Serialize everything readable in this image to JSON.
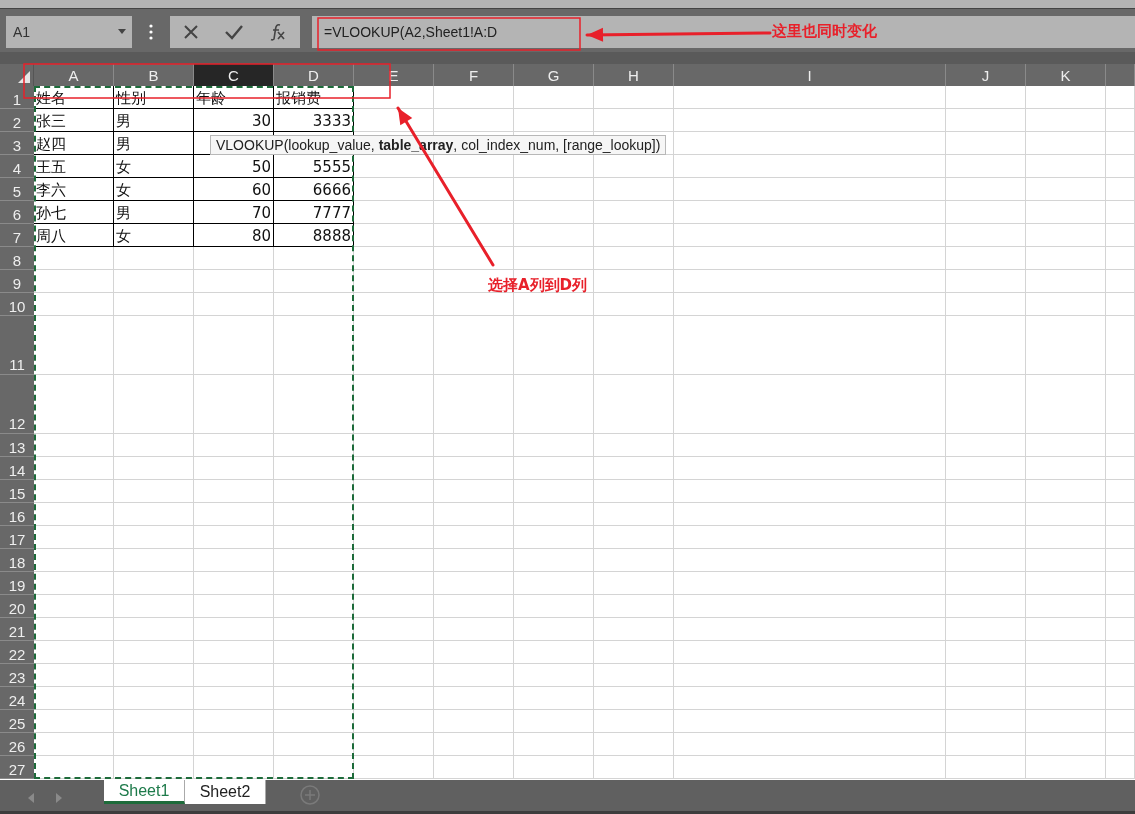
{
  "name_box": {
    "value": "A1"
  },
  "formula_bar": {
    "value": "=VLOOKUP(A2,Sheet1!A:D"
  },
  "columns": [
    {
      "label": "A",
      "selected": false,
      "in_reference": true
    },
    {
      "label": "B",
      "selected": false,
      "in_reference": true
    },
    {
      "label": "C",
      "selected": true,
      "in_reference": true
    },
    {
      "label": "D",
      "selected": false,
      "in_reference": true
    },
    {
      "label": "E",
      "selected": false,
      "in_reference": false
    },
    {
      "label": "F",
      "selected": false,
      "in_reference": false
    },
    {
      "label": "G",
      "selected": false,
      "in_reference": false
    },
    {
      "label": "H",
      "selected": false,
      "in_reference": false
    },
    {
      "label": "I",
      "selected": false,
      "in_reference": false
    },
    {
      "label": "J",
      "selected": false,
      "in_reference": false
    },
    {
      "label": "K",
      "selected": false,
      "in_reference": false
    }
  ],
  "rows": [
    {
      "label": "1",
      "tall": false,
      "cells": [
        {
          "text": "姓名",
          "kind": "text"
        },
        {
          "text": "性别",
          "kind": "text"
        },
        {
          "text": "年龄",
          "kind": "text"
        },
        {
          "text": "报销费",
          "kind": "text"
        }
      ]
    },
    {
      "label": "2",
      "tall": false,
      "cells": [
        {
          "text": "张三",
          "kind": "text"
        },
        {
          "text": "男",
          "kind": "text"
        },
        {
          "text": "30",
          "kind": "number"
        },
        {
          "text": "3333",
          "kind": "number"
        }
      ]
    },
    {
      "label": "3",
      "tall": false,
      "cells": [
        {
          "text": "赵四",
          "kind": "text"
        },
        {
          "text": "男",
          "kind": "text"
        }
      ]
    },
    {
      "label": "4",
      "tall": false,
      "cells": [
        {
          "text": "王五",
          "kind": "text"
        },
        {
          "text": "女",
          "kind": "text"
        },
        {
          "text": "50",
          "kind": "number"
        },
        {
          "text": "5555",
          "kind": "number"
        }
      ]
    },
    {
      "label": "5",
      "tall": false,
      "cells": [
        {
          "text": "李六",
          "kind": "text"
        },
        {
          "text": "女",
          "kind": "text"
        },
        {
          "text": "60",
          "kind": "number"
        },
        {
          "text": "6666",
          "kind": "number"
        }
      ]
    },
    {
      "label": "6",
      "tall": false,
      "cells": [
        {
          "text": "孙七",
          "kind": "text"
        },
        {
          "text": "男",
          "kind": "text"
        },
        {
          "text": "70",
          "kind": "number"
        },
        {
          "text": "7777",
          "kind": "number"
        }
      ]
    },
    {
      "label": "7",
      "tall": false,
      "cells": [
        {
          "text": "周八",
          "kind": "text"
        },
        {
          "text": "女",
          "kind": "text"
        },
        {
          "text": "80",
          "kind": "number"
        },
        {
          "text": "8888",
          "kind": "number"
        }
      ]
    },
    {
      "label": "8",
      "tall": false,
      "cells": []
    },
    {
      "label": "9",
      "tall": false,
      "cells": []
    },
    {
      "label": "10",
      "tall": false,
      "cells": []
    },
    {
      "label": "11",
      "tall": true,
      "cells": []
    },
    {
      "label": "12",
      "tall": true,
      "cells": []
    },
    {
      "label": "13",
      "tall": false,
      "cells": []
    },
    {
      "label": "14",
      "tall": false,
      "cells": []
    },
    {
      "label": "15",
      "tall": false,
      "cells": []
    },
    {
      "label": "16",
      "tall": false,
      "cells": []
    },
    {
      "label": "17",
      "tall": false,
      "cells": []
    },
    {
      "label": "18",
      "tall": false,
      "cells": []
    },
    {
      "label": "19",
      "tall": false,
      "cells": []
    },
    {
      "label": "20",
      "tall": false,
      "cells": []
    },
    {
      "label": "21",
      "tall": false,
      "cells": []
    },
    {
      "label": "22",
      "tall": false,
      "cells": []
    },
    {
      "label": "23",
      "tall": false,
      "cells": []
    },
    {
      "label": "24",
      "tall": false,
      "cells": []
    },
    {
      "label": "25",
      "tall": false,
      "cells": []
    },
    {
      "label": "26",
      "tall": false,
      "cells": []
    },
    {
      "label": "27",
      "tall": false,
      "cells": []
    }
  ],
  "tooltip": {
    "text": "VLOOKUP(lookup_value, **table_array**, col_index_num, [range_lookup])"
  },
  "sheet_tabs": [
    {
      "label": "Sheet1",
      "selected": true
    },
    {
      "label": "Sheet2",
      "selected": false
    }
  ],
  "annotations": [
    {
      "kind": "box"
    },
    {
      "kind": "box"
    },
    {
      "kind": "arrow"
    },
    {
      "kind": "arrow"
    },
    {
      "kind": "label",
      "text": "这里也同时变化"
    },
    {
      "kind": "label",
      "text": "选择A列到D列"
    }
  ]
}
